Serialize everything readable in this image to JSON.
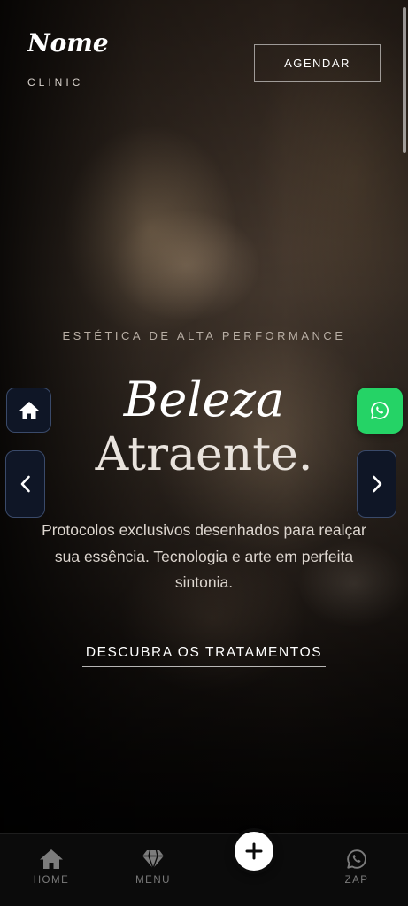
{
  "brand": {
    "name": "Nome",
    "subtitle": "CLINIC"
  },
  "header": {
    "cta_label": "AGENDAR"
  },
  "hero": {
    "kicker": "ESTÉTICA DE ALTA PERFORMANCE",
    "headline_line1": "Beleza",
    "headline_line2": "Atraente.",
    "description": "Protocolos exclusivos desenhados para realçar sua essência. Tecnologia e arte em perfeita sintonia.",
    "cta_label": "DESCUBRA OS TRATAMENTOS"
  },
  "bottom_nav": {
    "items": [
      {
        "label": "HOME",
        "icon": "home-icon"
      },
      {
        "label": "MENU",
        "icon": "diamond-icon"
      },
      {
        "label": "",
        "icon": "plus-icon"
      },
      {
        "label": "ZAP",
        "icon": "whatsapp-icon"
      }
    ]
  },
  "colors": {
    "whatsapp_green": "#25d366",
    "side_button_bg": "#0f1626",
    "nav_bg": "#0b0b0b"
  }
}
